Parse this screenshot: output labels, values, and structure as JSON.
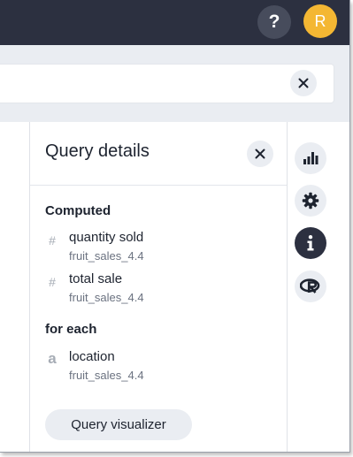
{
  "header": {
    "help_label": "?",
    "avatar_initial": "R"
  },
  "panel": {
    "title": "Query details",
    "computed_label": "Computed",
    "computed_items": [
      {
        "name": "quantity sold",
        "source": "fruit_sales_4.4",
        "type_glyph": "#"
      },
      {
        "name": "total sale",
        "source": "fruit_sales_4.4",
        "type_glyph": "#"
      }
    ],
    "foreach_label": "for each",
    "foreach_items": [
      {
        "name": "location",
        "source": "fruit_sales_4.4",
        "type_glyph": "a"
      }
    ],
    "visualizer_button": "Query visualizer"
  },
  "rail": {
    "icons": [
      "bar-chart-icon",
      "gear-icon",
      "info-icon",
      "r-logo-icon"
    ]
  },
  "colors": {
    "topbar": "#2c3040",
    "avatar": "#f4b733",
    "button_bg": "#eaedf2",
    "text": "#1d232f",
    "muted": "#a6acb5"
  }
}
